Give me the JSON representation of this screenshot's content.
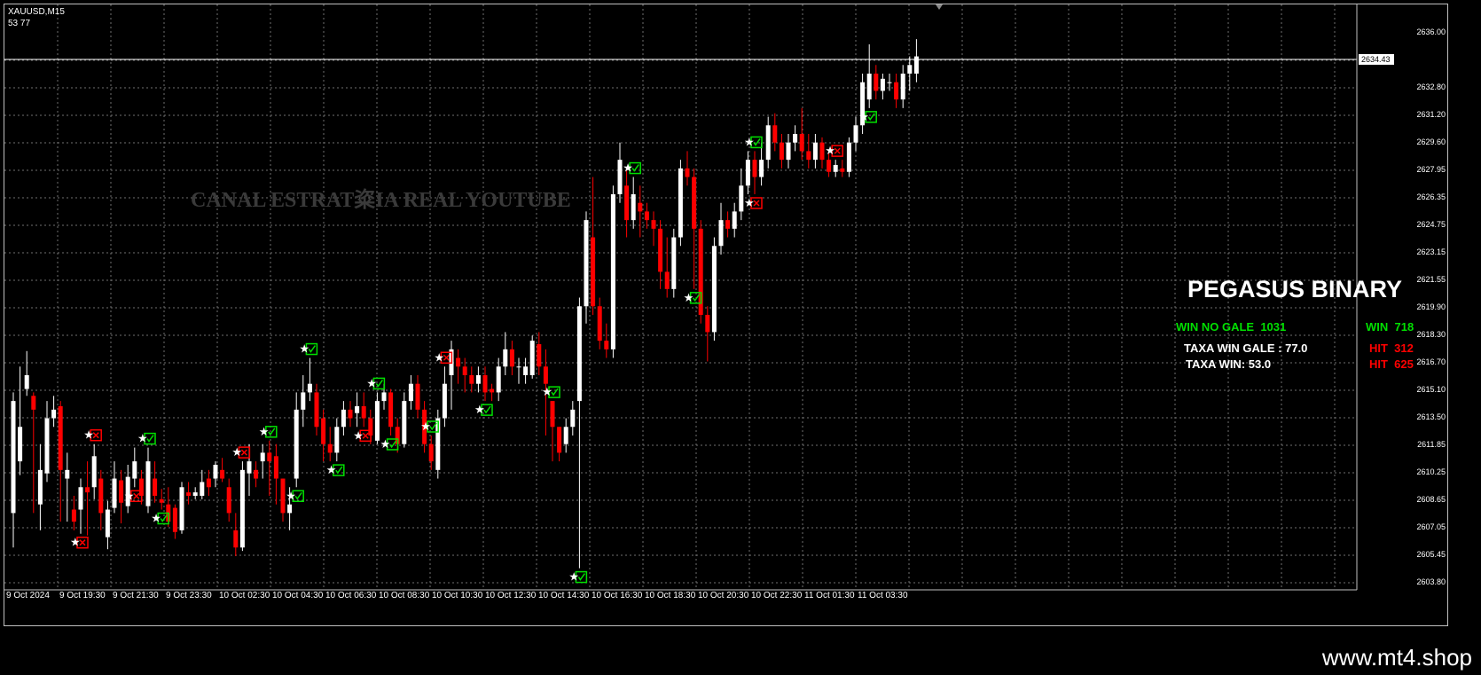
{
  "window": {
    "symbol": "XAUUSD,M15",
    "counter": "53 77"
  },
  "watermark": "CANAL ESTRAT粢IA REAL YOUTUBE",
  "panel": {
    "title": "PEGASUS BINARY",
    "win_no_gale": "WIN NO GALE  1031",
    "win": "WIN  718",
    "taxa_win_gale": "TAXA WIN GALE : 77.0",
    "hit1": "HIT  312",
    "taxa_win": "TAXA WIN: 53.0",
    "hit2": "HIT  625"
  },
  "price_axis": [
    "2636.00",
    "2634.43",
    "2632.80",
    "2631.20",
    "2629.60",
    "2627.95",
    "2626.35",
    "2624.75",
    "2623.15",
    "2621.55",
    "2619.90",
    "2618.30",
    "2616.70",
    "2615.10",
    "2613.50",
    "2611.85",
    "2610.25",
    "2608.65",
    "2607.05",
    "2605.45",
    "2603.80"
  ],
  "current_price": "2634.43",
  "time_axis": [
    "9 Oct 2024",
    "9 Oct 19:30",
    "9 Oct 21:30",
    "9 Oct 23:30",
    "10 Oct 02:30",
    "10 Oct 04:30",
    "10 Oct 06:30",
    "10 Oct 08:30",
    "10 Oct 10:30",
    "10 Oct 12:30",
    "10 Oct 14:30",
    "10 Oct 16:30",
    "10 Oct 18:30",
    "10 Oct 20:30",
    "10 Oct 22:30",
    "11 Oct 01:30",
    "11 Oct 03:30"
  ],
  "footer": {
    "site": "www.mt4.shop"
  },
  "colors": {
    "bull": "#ffffff",
    "bear": "#ff0000",
    "grid": "#707070",
    "win_marker": "#00e000",
    "loss_marker": "#ff0000"
  },
  "chart_data": {
    "type": "candlestick",
    "ylim": [
      2603.8,
      2637.0
    ],
    "candles": [
      [
        2608.0,
        2614.5,
        2606.0,
        2615.0
      ],
      [
        2611.0,
        2613.0,
        2610.2,
        2616.5
      ],
      [
        2615.2,
        2616.0,
        2614.8,
        2617.4
      ],
      [
        2614.8,
        2614.0,
        2608.0,
        2615.0
      ],
      [
        2608.5,
        2610.5,
        2607.0,
        2612.0
      ],
      [
        2610.3,
        2613.5,
        2609.8,
        2614.5
      ],
      [
        2613.5,
        2614.0,
        2613.0,
        2614.8
      ],
      [
        2614.2,
        2610.5,
        2607.5,
        2614.5
      ],
      [
        2610.0,
        2610.5,
        2607.5,
        2611.5
      ],
      [
        2608.2,
        2607.5,
        2607.0,
        2609.0
      ],
      [
        2608.2,
        2609.5,
        2606.8,
        2610.0
      ],
      [
        2609.5,
        2609.2,
        2606.7,
        2611.0
      ],
      [
        2609.5,
        2611.3,
        2608.8,
        2612.0
      ],
      [
        2610.0,
        2608.0,
        2607.0,
        2610.5
      ],
      [
        2606.6,
        2608.2,
        2605.9,
        2608.7
      ],
      [
        2608.3,
        2610.0,
        2608.0,
        2611.0
      ],
      [
        2609.9,
        2608.6,
        2607.4,
        2610.5
      ],
      [
        2608.4,
        2610.1,
        2608.0,
        2610.8
      ],
      [
        2610.0,
        2611.0,
        2609.5,
        2611.8
      ],
      [
        2610.0,
        2609.0,
        2608.5,
        2610.5
      ],
      [
        2608.4,
        2611.0,
        2608.0,
        2611.8
      ],
      [
        2610.0,
        2609.0,
        2608.6,
        2611.0
      ],
      [
        2608.8,
        2608.6,
        2608.2,
        2609.4
      ],
      [
        2608.5,
        2607.5,
        2607.2,
        2609.5
      ],
      [
        2608.3,
        2606.9,
        2606.5,
        2608.5
      ],
      [
        2607.0,
        2609.5,
        2606.8,
        2609.8
      ],
      [
        2609.2,
        2609.0,
        2608.5,
        2609.8
      ],
      [
        2609.0,
        2609.2,
        2608.8,
        2609.5
      ],
      [
        2609.0,
        2609.8,
        2608.8,
        2610.5
      ],
      [
        2610.0,
        2609.5,
        2609.0,
        2610.5
      ],
      [
        2610.0,
        2610.8,
        2609.5,
        2611.0
      ],
      [
        2610.5,
        2610.0,
        2609.8,
        2611.2
      ],
      [
        2609.5,
        2608.0,
        2607.5,
        2610.0
      ],
      [
        2607.0,
        2606.0,
        2605.5,
        2608.0
      ],
      [
        2606.0,
        2610.5,
        2605.8,
        2611.0
      ],
      [
        2610.3,
        2611.0,
        2609.0,
        2612.0
      ],
      [
        2610.5,
        2610.0,
        2609.5,
        2611.0
      ],
      [
        2611.0,
        2611.5,
        2610.0,
        2612.0
      ],
      [
        2611.5,
        2611.0,
        2609.0,
        2612.2
      ],
      [
        2611.3,
        2610.0,
        2608.5,
        2612.0
      ],
      [
        2610.0,
        2608.0,
        2607.5,
        2610.0
      ],
      [
        2608.0,
        2608.5,
        2607.0,
        2609.5
      ],
      [
        2610.0,
        2614.0,
        2609.5,
        2615.0
      ],
      [
        2614.0,
        2615.0,
        2613.0,
        2616.0
      ],
      [
        2615.0,
        2615.5,
        2614.5,
        2617.0
      ],
      [
        2615.0,
        2613.0,
        2612.5,
        2615.5
      ],
      [
        2613.5,
        2612.0,
        2611.0,
        2614.0
      ],
      [
        2612.0,
        2611.5,
        2611.0,
        2613.0
      ],
      [
        2611.5,
        2613.0,
        2611.0,
        2613.5
      ],
      [
        2613.0,
        2614.0,
        2612.5,
        2614.5
      ],
      [
        2614.0,
        2613.5,
        2613.0,
        2614.5
      ],
      [
        2613.8,
        2614.2,
        2613.0,
        2615.0
      ],
      [
        2614.2,
        2613.5,
        2613.0,
        2615.0
      ],
      [
        2613.5,
        2612.5,
        2612.0,
        2614.0
      ],
      [
        2612.2,
        2614.5,
        2612.0,
        2615.0
      ],
      [
        2614.5,
        2615.0,
        2614.0,
        2615.5
      ],
      [
        2615.0,
        2613.0,
        2612.5,
        2615.2
      ],
      [
        2613.0,
        2612.0,
        2611.5,
        2613.5
      ],
      [
        2612.0,
        2614.5,
        2611.8,
        2615.0
      ],
      [
        2614.5,
        2615.5,
        2614.0,
        2616.0
      ],
      [
        2615.5,
        2614.0,
        2613.5,
        2616.0
      ],
      [
        2614.0,
        2612.0,
        2611.5,
        2614.5
      ],
      [
        2612.0,
        2611.0,
        2610.5,
        2612.5
      ],
      [
        2610.5,
        2613.5,
        2610.0,
        2614.0
      ],
      [
        2613.5,
        2615.5,
        2613.0,
        2616.5
      ],
      [
        2616.0,
        2617.5,
        2614.0,
        2618.0
      ],
      [
        2617.0,
        2616.5,
        2615.5,
        2617.5
      ],
      [
        2616.5,
        2616.0,
        2615.0,
        2617.0
      ],
      [
        2616.0,
        2615.5,
        2615.0,
        2616.5
      ],
      [
        2615.5,
        2616.0,
        2615.0,
        2616.5
      ],
      [
        2616.0,
        2615.0,
        2614.5,
        2616.5
      ],
      [
        2615.2,
        2615.0,
        2614.5,
        2615.5
      ],
      [
        2615.0,
        2616.5,
        2614.5,
        2617.0
      ],
      [
        2616.5,
        2617.5,
        2616.0,
        2618.5
      ],
      [
        2617.5,
        2616.5,
        2616.0,
        2618.0
      ],
      [
        2616.5,
        2616.5,
        2615.5,
        2617.0
      ],
      [
        2616.0,
        2616.5,
        2615.5,
        2617.0
      ],
      [
        2616.0,
        2618.0,
        2615.8,
        2618.3
      ],
      [
        2617.8,
        2616.5,
        2616.0,
        2618.5
      ],
      [
        2616.5,
        2615.5,
        2612.5,
        2617.5
      ],
      [
        2614.5,
        2613.0,
        2611.0,
        2614.5
      ],
      [
        2613.0,
        2611.5,
        2611.0,
        2613.0
      ],
      [
        2612.0,
        2613.0,
        2611.5,
        2613.5
      ],
      [
        2613.0,
        2614.0,
        2612.5,
        2614.5
      ],
      [
        2614.5,
        2620.0,
        2604.8,
        2620.5
      ],
      [
        2620.0,
        2625.0,
        2619.0,
        2625.5
      ],
      [
        2624.0,
        2620.0,
        2619.5,
        2627.5
      ],
      [
        2620.0,
        2618.0,
        2617.5,
        2620.5
      ],
      [
        2618.0,
        2617.5,
        2617.0,
        2619.0
      ],
      [
        2617.5,
        2626.5,
        2617.0,
        2627.0
      ],
      [
        2626.5,
        2628.5,
        2626.0,
        2629.5
      ],
      [
        2627.0,
        2625.0,
        2624.0,
        2628.0
      ],
      [
        2625.0,
        2626.5,
        2624.5,
        2627.5
      ],
      [
        2626.0,
        2625.5,
        2624.0,
        2627.0
      ],
      [
        2625.5,
        2625.0,
        2624.5,
        2626.0
      ],
      [
        2625.0,
        2624.5,
        2623.5,
        2625.5
      ],
      [
        2624.5,
        2622.0,
        2621.0,
        2625.0
      ],
      [
        2622.0,
        2621.0,
        2620.5,
        2624.0
      ],
      [
        2621.0,
        2624.0,
        2620.5,
        2624.5
      ],
      [
        2624.0,
        2628.0,
        2623.5,
        2628.5
      ],
      [
        2628.0,
        2627.5,
        2627.0,
        2629.0
      ],
      [
        2627.5,
        2624.5,
        2621.0,
        2628.0
      ],
      [
        2624.5,
        2619.5,
        2619.0,
        2625.0
      ],
      [
        2619.5,
        2618.5,
        2616.8,
        2620.0
      ],
      [
        2618.5,
        2623.5,
        2618.0,
        2624.0
      ],
      [
        2623.5,
        2625.0,
        2623.0,
        2626.0
      ],
      [
        2625.0,
        2624.5,
        2624.0,
        2625.5
      ],
      [
        2624.5,
        2625.5,
        2624.0,
        2626.0
      ],
      [
        2625.5,
        2627.0,
        2625.0,
        2628.0
      ],
      [
        2627.0,
        2628.5,
        2626.5,
        2629.0
      ],
      [
        2628.5,
        2627.5,
        2626.5,
        2629.0
      ],
      [
        2627.5,
        2628.5,
        2627.0,
        2629.5
      ],
      [
        2628.5,
        2630.5,
        2628.0,
        2631.0
      ],
      [
        2630.5,
        2629.5,
        2629.0,
        2631.2
      ],
      [
        2629.5,
        2628.5,
        2628.0,
        2630.0
      ],
      [
        2628.5,
        2629.5,
        2628.0,
        2630.0
      ],
      [
        2629.5,
        2630.0,
        2629.0,
        2630.5
      ],
      [
        2630.0,
        2629.0,
        2628.5,
        2631.5
      ],
      [
        2629.0,
        2628.5,
        2628.0,
        2630.0
      ],
      [
        2628.5,
        2629.5,
        2628.0,
        2630.0
      ],
      [
        2629.5,
        2628.5,
        2628.0,
        2629.8
      ],
      [
        2628.5,
        2627.8,
        2627.5,
        2629.0
      ],
      [
        2627.8,
        2628.2,
        2627.5,
        2628.5
      ],
      [
        2628.0,
        2627.8,
        2627.5,
        2628.5
      ],
      [
        2627.8,
        2629.5,
        2627.5,
        2629.8
      ],
      [
        2629.5,
        2630.5,
        2629.0,
        2631.0
      ],
      [
        2630.5,
        2633.0,
        2630.0,
        2633.5
      ],
      [
        2632.0,
        2633.5,
        2631.5,
        2635.2
      ],
      [
        2633.5,
        2632.5,
        2632.0,
        2634.0
      ],
      [
        2632.5,
        2633.2,
        2632.0,
        2633.5
      ],
      [
        2633.0,
        2633.0,
        2632.5,
        2633.5
      ],
      [
        2633.0,
        2632.0,
        2631.5,
        2633.5
      ],
      [
        2632.0,
        2633.5,
        2631.5,
        2634.0
      ],
      [
        2633.5,
        2634.0,
        2632.5,
        2634.5
      ],
      [
        2633.5,
        2634.5,
        2633.0,
        2635.5
      ]
    ],
    "win_markers": [
      20,
      22,
      38,
      42,
      44,
      48,
      54,
      56,
      62,
      70,
      80,
      84,
      92,
      101,
      110,
      127
    ],
    "loss_markers": [
      10,
      12,
      18,
      34,
      52,
      64,
      110,
      122
    ]
  }
}
